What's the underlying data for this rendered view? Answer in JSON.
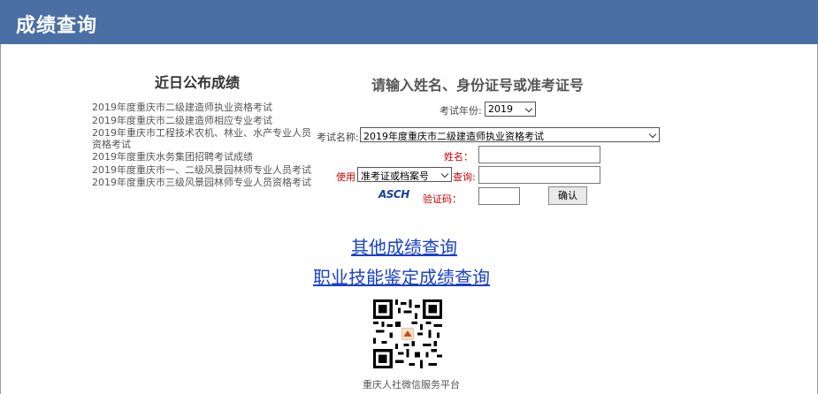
{
  "header": {
    "title": "成绩查询"
  },
  "recent": {
    "title": "近日公布成绩",
    "items": [
      "2019年度重庆市二级建造师执业资格考试",
      "2019年度重庆市二级建造师相应专业考试",
      "2019年重庆市工程技术农机、林业、水产专业人员资格考试",
      "2019年度重庆水务集团招聘考试成绩",
      "2019年度重庆市一、二级风景园林师专业人员考试",
      "2019年度重庆市三级风景园林师专业人员资格考试"
    ]
  },
  "form": {
    "title": "请输入姓名、身份证号或准考证号",
    "year_label": "考试年份:",
    "year_value": "2019",
    "exam_label": "考试名称:",
    "exam_value": "2019年度重庆市二级建造师执业资格考试",
    "name_label": "姓名：",
    "use_label": "使用",
    "id_type_value": "准考证或档案号",
    "query_label": "查询:",
    "captcha_text": "ASCH",
    "captcha_label": "验证码：",
    "confirm_label": "确认"
  },
  "links": {
    "other": "其他成绩查询",
    "skill": "职业技能鉴定成绩查询"
  },
  "qr": {
    "caption": "重庆人社微信服务平台"
  },
  "colors": {
    "header_bg": "#4a6fa5",
    "link": "#1a40c8",
    "label_red": "#cc0000"
  }
}
